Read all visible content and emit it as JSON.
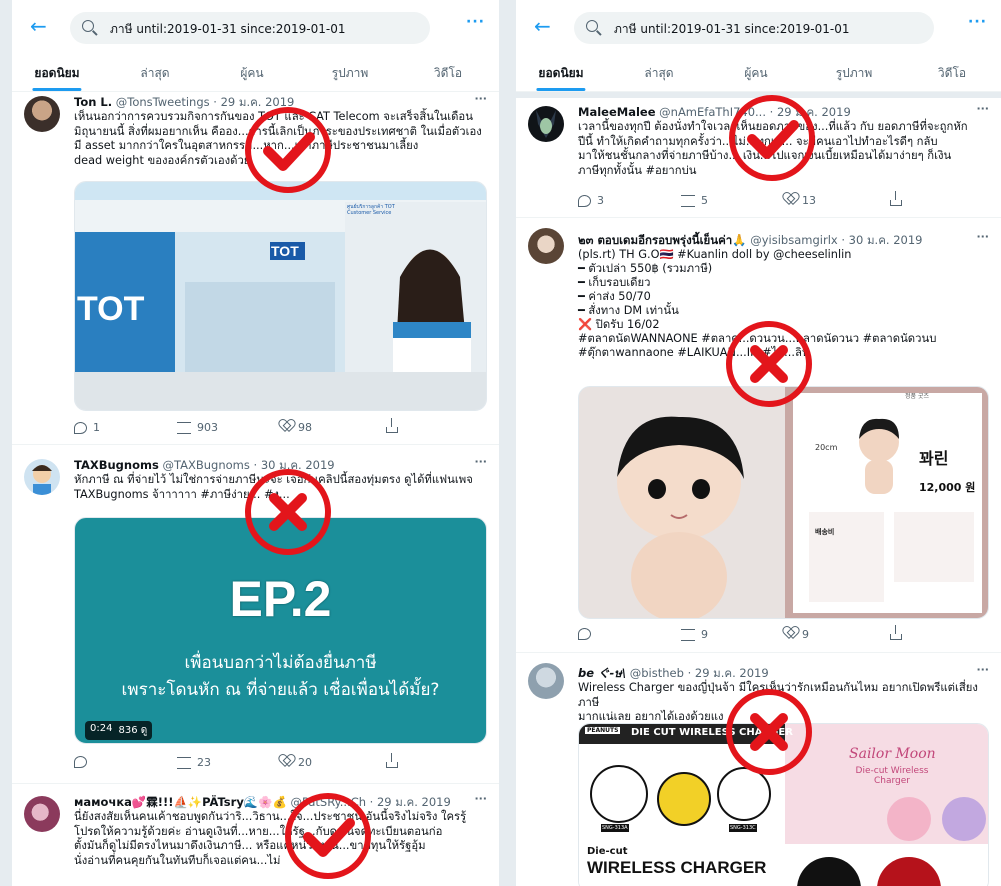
{
  "search": {
    "query": "ภาษี until:2019-01-31 since:2019-01-01"
  },
  "tabs": [
    "ยอดนิยม",
    "ล่าสุด",
    "ผู้คน",
    "รูปภาพ",
    "วิดีโอ"
  ],
  "left_tweets": [
    {
      "name": "Ton L.",
      "handle": "@TonsTweetings · 29 ม.ค. 2019",
      "text": "เห็นนอกว่าการควบรวมกิจการกันของ TOT และ CAT Telecom จะเสร็จสิ้นในเดือน\nมิถุนายนนี้ สิ่งที่ผมอยากเห็น คืออง...การนี้เลิกเป็นภาระของประเทศชาติ ในเมื่อตัวเอง\nมี asset มากกว่าใครในอุตสาหกรรม...หาก...เอาภาษีประชาชนมาเลี้ยง\ndead weight ขององค์กรตัวเองด้วย",
      "media": {
        "brand": "TOT",
        "side_text": "ศูนย์บริการลูกค้า TOT Customer Service"
      },
      "replies": "1",
      "retweets": "903",
      "likes": "98"
    },
    {
      "name": "TAXBugnoms",
      "handle": "@TAXBugnoms · 30 ม.ค. 2019",
      "text": "หักภาษี ณ ที่จ่ายไว้ ไม่ใช่การจ่ายภาษีนะจ๊ะ เจอกันคลิปนี้สองทุ่มตรง ดูได้ที่แฟนเพจ\nTAXBugnoms จ้าาาาาา #ภาษีง่าย... #ง...",
      "media": {
        "title": "EP.2",
        "line1": "เพื่อนบอกว่าไม่ต้องยื่นภาษี",
        "line2": "เพราะโดนหัก ณ ที่จ่ายแล้ว เชื่อเพื่อนได้มั้ย?",
        "duration": "0:24",
        "views": "836 ดู"
      },
      "replies": "",
      "retweets": "23",
      "likes": "20"
    },
    {
      "name": "мамочка💕霖!!!⛵✨PÄTsry🌊🌸💰",
      "handle": "@PatSRy...Ch · 29 ม.ค. 2019",
      "text": "นี่ยังสงสัยเห็นคนเค้าชอบพูดกันว่าริ...วิธาน...ใจ...ประชาชน อันนี้จริงไม่จริง ใครรู้\nโปรดให้ความรู้ด้วยค่ะ อ่านดูเงินที่...หาย...ให้รัฐ...กับดูเงินจดทะเบียนตอนก่อ\nตั้งมันก็ดูไม่มีตรงไหนมาดึงเงินภาษี... หรือแค่หน่วยงาน...ขาดทุนให้รัฐอุ้ม\nนั่งอ่านที่คนคุยกันในทันทีบก็เจอแต่คน...ไม่"
    }
  ],
  "right_tweets": [
    {
      "name": "MaleeMalee",
      "handle": "@nAmEfaThI740... · 29 ม.ค. 2019",
      "text": "เวลานี้ของทุกปี ต้องนั่งทำใจเวลาเห็นยอดภาษีของ...ที่แล้ว กับ ยอดภาษีที่จะถูกหัก\nปีนี้ ทำให้เกิดคำถามทุกครั้งว่า...ไม่...ทุกเล... จะมีคนเอาไปทำอะไรดีๆ กลับ\nมาให้ชนชั้นกลางที่จ่ายภาษีบ้าง... เงิน...ไปแจกเงินเบี้ยเหมือนได้มาง่ายๆ ก็เงิน\nภาษีทุกทั้งนั้น #อยากบ่น",
      "replies": "3",
      "retweets": "5",
      "likes": "13"
    },
    {
      "name": "๒๓ ตอบเดมอีกรอบพรุ่งนี้เย็นค่า🙏",
      "handle": "@yisibsamgirlx · 30 ม.ค. 2019",
      "text": "(pls.rt) TH G.O🇹🇭 #Kuanlin doll by @cheeselinlin\n━ ตัวเปล่า 550฿ (รวมภาษี)\n━ เก็บรอบเดียว\n━ ค่าส่ง 50/70\n━ สั่งทาง DM เท่านั้น\n❌ ปิดรับ 16/02\n#ตลาดนัดWANNAONE #ตลาด...ดวนวน...ตลาดนัดวนว #ตลาดนัดวนบ\n#ตุ๊กตาwannaone #LAIKUAN...IN #ไล...ลิน",
      "media": {
        "korean_title": "꽈린",
        "size": "20cm",
        "price": "12,000 원",
        "note": "배송비"
      },
      "replies": "",
      "retweets": "9",
      "likes": "9"
    },
    {
      "name": "be ぐ-ษ\\",
      "handle": "@bistheb · 29 ม.ค. 2019",
      "text": "Wireless Charger ของญี่ปุ่นจ้า มีใครเห็นว่ารักเหมือนกันไหม อยากเปิดพรีแต่เสี่ยงภาษี\nมากแน่เลย อยากได้เองด้วยแง",
      "media": {
        "banner": "DIE CUT WIRELESS CHARGER",
        "peanuts": "PEANUTS",
        "sailor": "Sailor Moon",
        "sailor_sub": "Die-cut Wireless Charger",
        "bottom": "WIRELESS CHARGER",
        "diecut": "Die-cut",
        "sku1": "SNG-313A",
        "sku2": "SNG-313C"
      }
    }
  ]
}
